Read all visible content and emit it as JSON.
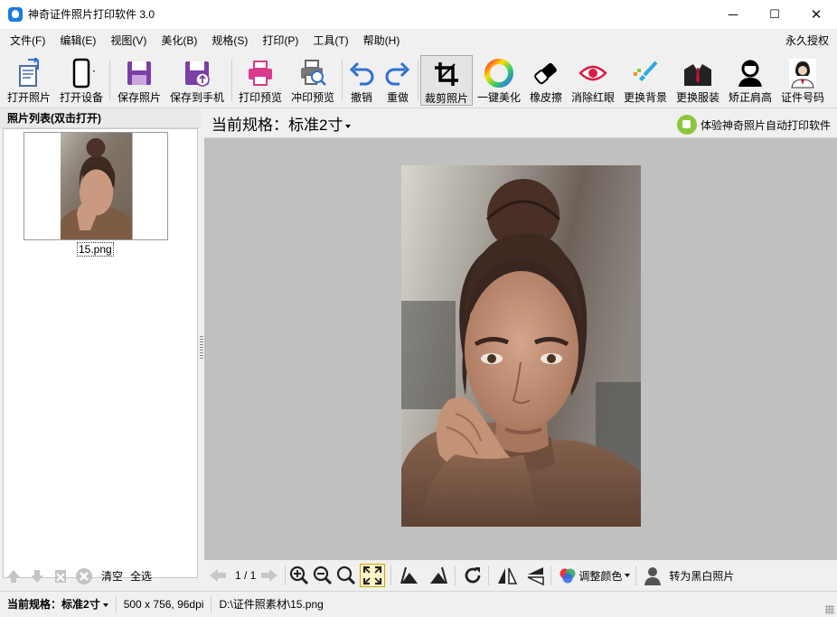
{
  "window": {
    "title": "神奇证件照片打印软件 3.0",
    "minimize": "─",
    "maximize": "☐",
    "close": "✕"
  },
  "menu": {
    "items": [
      "文件(F)",
      "编辑(E)",
      "视图(V)",
      "美化(B)",
      "规格(S)",
      "打印(P)",
      "工具(T)",
      "帮助(H)"
    ],
    "license": "永久授权"
  },
  "toolbar": {
    "open_photo": "打开照片",
    "open_device": "打开设备",
    "save_photo": "保存照片",
    "save_to_phone": "保存到手机",
    "print_preview": "打印预览",
    "develop_preview": "冲印预览",
    "undo": "撤销",
    "redo": "重做",
    "crop_photo": "裁剪照片",
    "one_click_beautify": "一键美化",
    "eraser": "橡皮擦",
    "remove_red_eye": "消除红眼",
    "change_background": "更换背景",
    "change_clothes": "更换服装",
    "correct_shoulders": "矫正肩高",
    "id_number": "证件号码"
  },
  "left_panel": {
    "title": "照片列表(双击打开)",
    "items": [
      {
        "filename": "15.png"
      }
    ],
    "clear": "清空",
    "select_all": "全选"
  },
  "main": {
    "spec_prefix": "当前规格：",
    "spec_value": "标准2寸",
    "promo": "体验神奇照片自动打印软件",
    "page_indicator": "1 / 1",
    "adjust_color": "调整颜色",
    "to_bw": "转为黑白照片"
  },
  "status": {
    "spec_prefix": "当前规格：",
    "spec_value": "标准2寸",
    "dimensions": "500 x 756, 96dpi",
    "path": "D:\\证件照素材\\15.png"
  },
  "colors": {
    "accent": "#1a7be0",
    "canvas_bg": "#c0c0c0",
    "save_purple": "#7b3fa6",
    "print_pink": "#d93a8c",
    "undo_blue": "#2f6fd6"
  }
}
